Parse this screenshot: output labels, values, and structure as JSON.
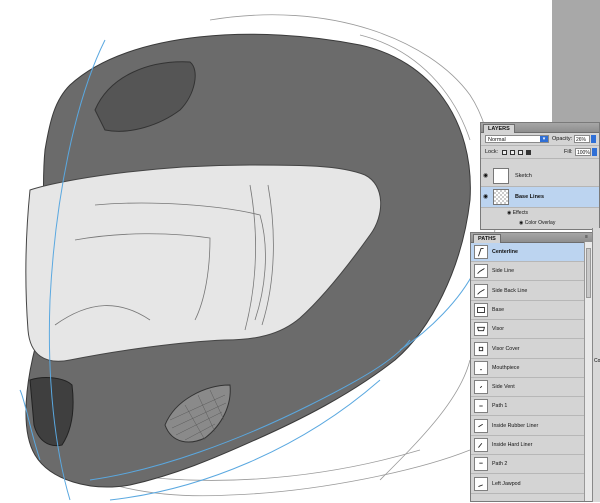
{
  "layers_panel": {
    "tab_label": "LAYERS",
    "blend_mode": "Normal",
    "opacity_label": "Opacity:",
    "opacity_value": "26%",
    "lock_label": "Lock:",
    "fill_label": "Fill:",
    "fill_value": "100%",
    "layers": [
      {
        "name": "Sketch",
        "selected": false
      },
      {
        "name": "Base Lines",
        "selected": true
      }
    ],
    "effects_label": "Effects",
    "color_overlay_label": "Color Overlay"
  },
  "paths_panel": {
    "tab_label": "PATHS",
    "paths": [
      "Centerline",
      "Side Line",
      "Side Back Line",
      "Base",
      "Visor",
      "Visor Cover",
      "Mouthpiece",
      "Side Vent",
      "Path 1",
      "Inside Rubber Liner",
      "Inside Hard Liner",
      "Path 2",
      "Left Jawpod"
    ],
    "selected_index": 0
  },
  "edge_text": "Co",
  "colors": {
    "helmet_shell": "#6b6b6b",
    "guide_line": "#5aa8e0",
    "selection": "#bcd4f0",
    "panel_bg": "#d4d4d4"
  }
}
